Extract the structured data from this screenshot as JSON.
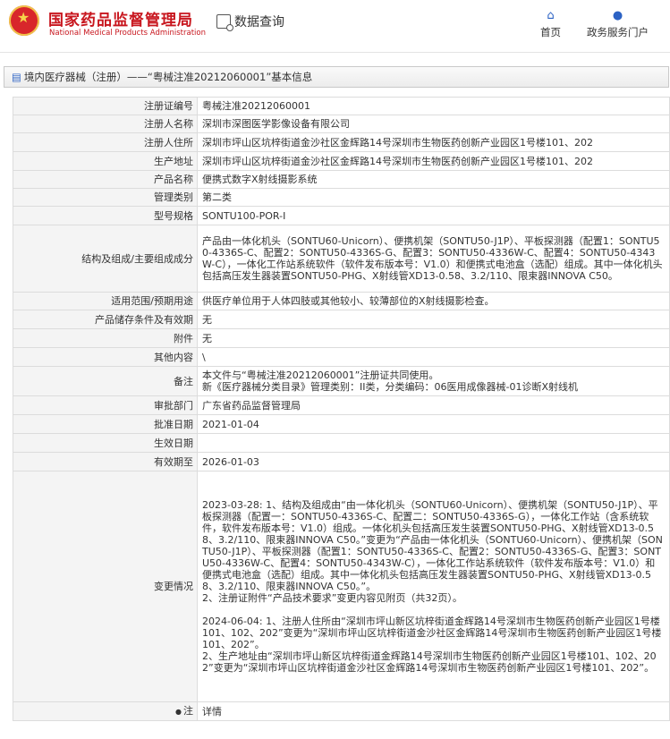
{
  "header": {
    "brand_cn": "国家药品监督管理局",
    "brand_en": "National Medical Products Administration",
    "query_label": "数据查询",
    "nav": {
      "home": "首页",
      "portal": "政务服务门户"
    }
  },
  "title": "境内医疗器械（注册）——“粤械注准20212060001”基本信息",
  "rows": [
    {
      "key": "注册证编号",
      "value": "粤械注准20212060001",
      "h": 20
    },
    {
      "key": "注册人名称",
      "value": "深圳市深图医学影像设备有限公司",
      "h": 20
    },
    {
      "key": "注册人住所",
      "value": "深圳市坪山区坑梓街道金沙社区金辉路14号深圳市生物医药创新产业园区1号楼101、202",
      "h": 21
    },
    {
      "key": "生产地址",
      "value": "深圳市坪山区坑梓街道金沙社区金辉路14号深圳市生物医药创新产业园区1号楼101、202",
      "h": 21
    },
    {
      "key": "产品名称",
      "value": "便携式数字X射线摄影系统",
      "h": 20
    },
    {
      "key": "管理类别",
      "value": "第二类",
      "h": 20
    },
    {
      "key": "型号规格",
      "value": "SONTU100-POR-I",
      "h": 21
    },
    {
      "key": "结构及组成/主要组成成分",
      "value": "产品由一体化机头（SONTU60-Unicorn）、便携机架（SONTU50-J1P）、平板探测器（配置1：SONTU50-4336S-C、配置2：SONTU50-4336S-G、配置3：SONTU50-4336W-C、配置4：SONTU50-4343W-C），一体化工作站系统软件（软件发布版本号：V1.0）和便携式电池盒（选配）组成。其中一体化机头包括高压发生器装置SONTU50-PHG、X射线管XD13-0.58、3.2/110、限束器INNOVA C50。",
      "h": 75
    },
    {
      "key": "适用范围/预期用途",
      "value": "供医疗单位用于人体四肢或其他较小、较薄部位的X射线摄影检查。",
      "h": 20
    },
    {
      "key": "产品储存条件及有效期",
      "value": "无",
      "h": 21
    },
    {
      "key": "附件",
      "value": "无",
      "h": 21
    },
    {
      "key": "其他内容",
      "value": "\\",
      "h": 21
    },
    {
      "key": "备注",
      "value": "本文件与“粤械注准20212060001”注册证共同使用。\n新《医疗器械分类目录》管理类别：II类，分类编码：06医用成像器械-01诊断X射线机",
      "h": 33
    },
    {
      "key": "审批部门",
      "value": "广东省药品监督管理局",
      "h": 21
    },
    {
      "key": "批准日期",
      "value": "2021-01-04",
      "h": 21
    },
    {
      "key": "生效日期",
      "value": "",
      "h": 21
    },
    {
      "key": "有效期至",
      "value": "2026-01-03",
      "h": 21
    },
    {
      "key": "变更情况",
      "value": "2023-03-28: 1、结构及组成由“由一体化机头（SONTU60-Unicorn）、便携机架（SONTU50-J1P）、平板探测器（配置一：SONTU50-4336S-C、配置二：SONTU50-4336S-G），一体化工作站（含系统软件，软件发布版本号：V1.0）组成。一体化机头包括高压发生装置SONTU50-PHG、X射线管XD13-0.58、3.2/110、限束器INNOVA C50。”变更为“产品由一体化机头（SONTU60-Unicorn）、便携机架（SONTU50-J1P）、平板探测器（配置1：SONTU50-4336S-C、配置2：SONTU50-4336S-G、配置3：SONTU50-4336W-C、配置4：SONTU50-4343W-C），一体化工作站系统软件（软件发布版本号：V1.0）和便携式电池盒（选配）组成。其中一体化机头包括高压发生器装置SONTU50-PHG、X射线管XD13-0.58、3.2/110、限束器INNOVA C50。”。\n2、注册证附件“产品技术要求”变更内容见附页（共32页）。\n\n2024-06-04: 1、注册人住所由“深圳市坪山新区坑梓街道金辉路14号深圳市生物医药创新产业园区1号楼101、102、202”变更为“深圳市坪山区坑梓街道金沙社区金辉路14号深圳市生物医药创新产业园区1号楼101、202”。\n2、生产地址由“深圳市坪山新区坑梓街道金辉路14号深圳市生物医药创新产业园区1号楼101、102、202”变更为“深圳市坪山区坑梓街道金沙社区金辉路14号深圳市生物医药创新产业园区1号楼101、202”。",
      "h": 258
    },
    {
      "key": "注",
      "value": "详情",
      "h": 21
    }
  ]
}
